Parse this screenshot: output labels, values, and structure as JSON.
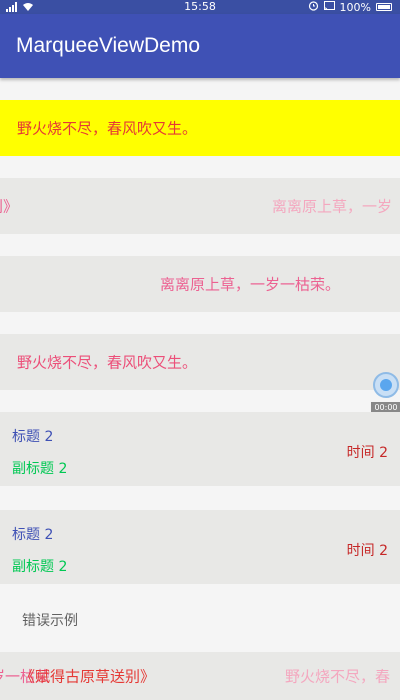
{
  "status": {
    "time": "15:58",
    "battery": "100%"
  },
  "app": {
    "title": "MarqueeViewDemo"
  },
  "marquee": {
    "row1": "野火烧不尽，春风吹又生。",
    "row2_a": "别》",
    "row2_b": "离离原上草，一岁",
    "row3": "离离原上草，一岁一枯荣。",
    "row4": "野火烧不尽，春风吹又生。"
  },
  "cards": [
    {
      "title": "标题 2",
      "subtitle": "副标题 2",
      "time": "时间 2"
    },
    {
      "title": "标题 2",
      "subtitle": "副标题 2",
      "time": "时间 2"
    }
  ],
  "error_example": "错误示例",
  "bottom": {
    "a": "岁一枯荣",
    "b": "《赋得古原草送别》",
    "c": "野火烧不尽，春"
  },
  "floating": {
    "label": "00:00"
  },
  "colors": {
    "primary": "#3f51b5",
    "status_bar": "#3a4fa3",
    "highlight": "#ffff00"
  }
}
